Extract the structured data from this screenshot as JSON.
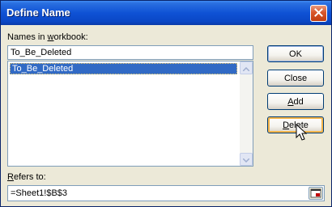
{
  "window": {
    "title": "Define Name"
  },
  "names": {
    "label_pre": "Names in ",
    "label_accel": "w",
    "label_post": "orkbook:",
    "input_value": "To_Be_Deleted",
    "items": [
      "To_Be_Deleted"
    ]
  },
  "buttons": {
    "ok": "OK",
    "close": "Close",
    "add_accel": "A",
    "add_post": "dd",
    "delete_accel": "D",
    "delete_post": "elete"
  },
  "refers": {
    "label_accel": "R",
    "label_post": "efers to:",
    "value": "=Sheet1!$B$3"
  },
  "icons": {
    "close": "close-icon",
    "scroll_up": "scroll-up-arrow-icon",
    "scroll_down": "scroll-down-arrow-icon",
    "collapse": "collapse-dialog-icon",
    "cursor": "mouse-pointer-icon"
  },
  "colors": {
    "titlebar": "#0F52D5",
    "selection": "#316AC5",
    "dialog_bg": "#ECE9D8",
    "close_button": "#D8562B"
  }
}
